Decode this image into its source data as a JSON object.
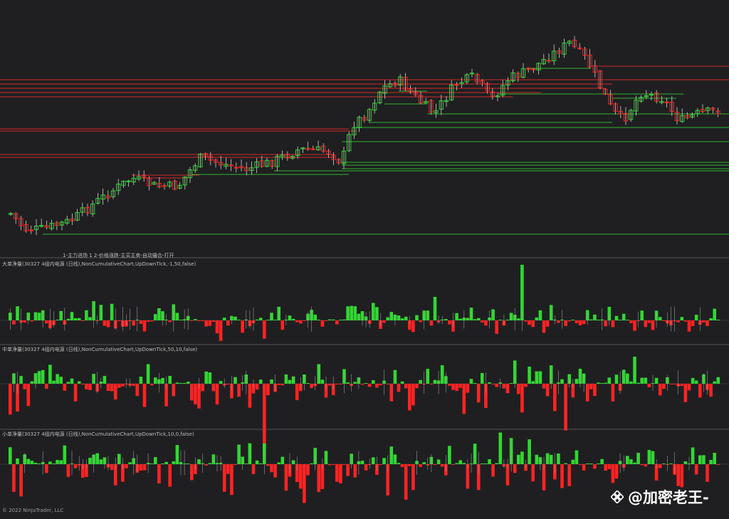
{
  "panels": {
    "price_caption": "1-主力进场 1 2-价格涨跌-主买主卖-自动撮合-打开",
    "large_label": "大单净量(30327 4组内电源 (日线),NonCumulativeChart,UpDownTick,-1,50,false)",
    "medium_label": "中单净量(30327 4组内电源 (日线),NonCumulativeChart,UpDownTick,50,10,false)",
    "small_label": "小单净量(30327 4组内电源 (日线),NonCumulativeChart,UpDownTick,10,0,false)"
  },
  "footer": {
    "copyright": "© 2022 NinjaTrader, LLC"
  },
  "watermark": {
    "text": "@加密老王-",
    "icon": "binance-square-icon"
  },
  "colors": {
    "background": "#1f1f21",
    "up": "#33d633",
    "down": "#ff2323",
    "separator": "#555555",
    "wick": "#d0d0d0"
  }
}
